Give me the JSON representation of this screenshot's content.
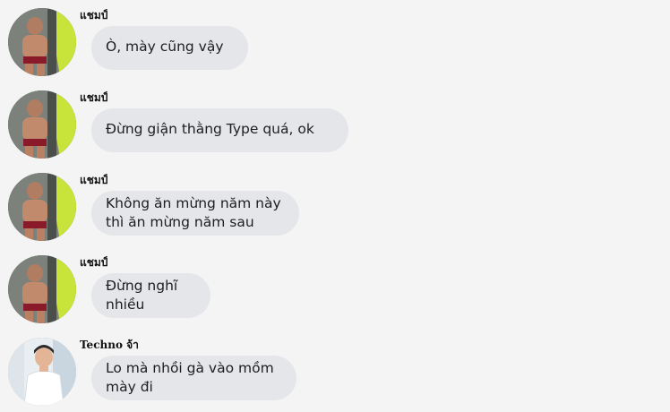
{
  "messages": [
    {
      "sender": "แชมป์",
      "text": "Ò, mày cũng vậy",
      "avatar": "user-shirtless-avatar"
    },
    {
      "sender": "แชมป์",
      "text": "Đừng giận thằng Type quá, ok",
      "avatar": "user-shirtless-avatar"
    },
    {
      "sender": "แชมป์",
      "text": "Không ăn mừng năm này\nthì ăn mừng năm sau",
      "avatar": "user-shirtless-avatar"
    },
    {
      "sender": "แชมป์",
      "text": "Đừng nghĩ\nnhiều",
      "avatar": "user-shirtless-avatar"
    },
    {
      "sender": "Techno จ้า",
      "text": "Lo mà nhồi gà vào mồm\nmày đi",
      "avatar": "user-white-shirt-avatar"
    }
  ],
  "colors": {
    "background": "#f4f4f4",
    "bubble": "#e4e6e9",
    "text": "#1c1e21",
    "sender": "#111111"
  }
}
